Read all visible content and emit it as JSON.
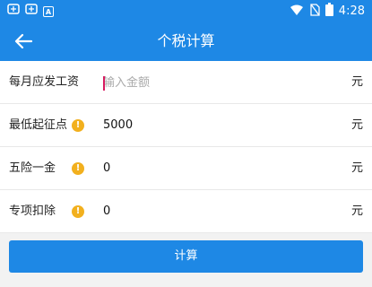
{
  "status_bar": {
    "left_icons": [
      "notification-icon",
      "notification-icon",
      "a-icon"
    ],
    "right_icons": [
      "wifi-icon",
      "no-sim-icon",
      "battery-icon"
    ],
    "time": "4:28"
  },
  "app_bar": {
    "title": "个税计算",
    "back_icon": "back-arrow-icon"
  },
  "form": {
    "rows": [
      {
        "label": "每月应发工资",
        "placeholder": "输入金额",
        "value": "",
        "unit": "元",
        "has_info": false
      },
      {
        "label": "最低起征点",
        "value": "5000",
        "unit": "元",
        "has_info": true
      },
      {
        "label": "五险一金",
        "value": "0",
        "unit": "元",
        "has_info": true
      },
      {
        "label": "专项扣除",
        "value": "0",
        "unit": "元",
        "has_info": true
      }
    ]
  },
  "actions": {
    "calculate_label": "计算"
  },
  "colors": {
    "primary": "#1e88e5",
    "info": "#f2b01e",
    "cursor": "#d81b60"
  }
}
